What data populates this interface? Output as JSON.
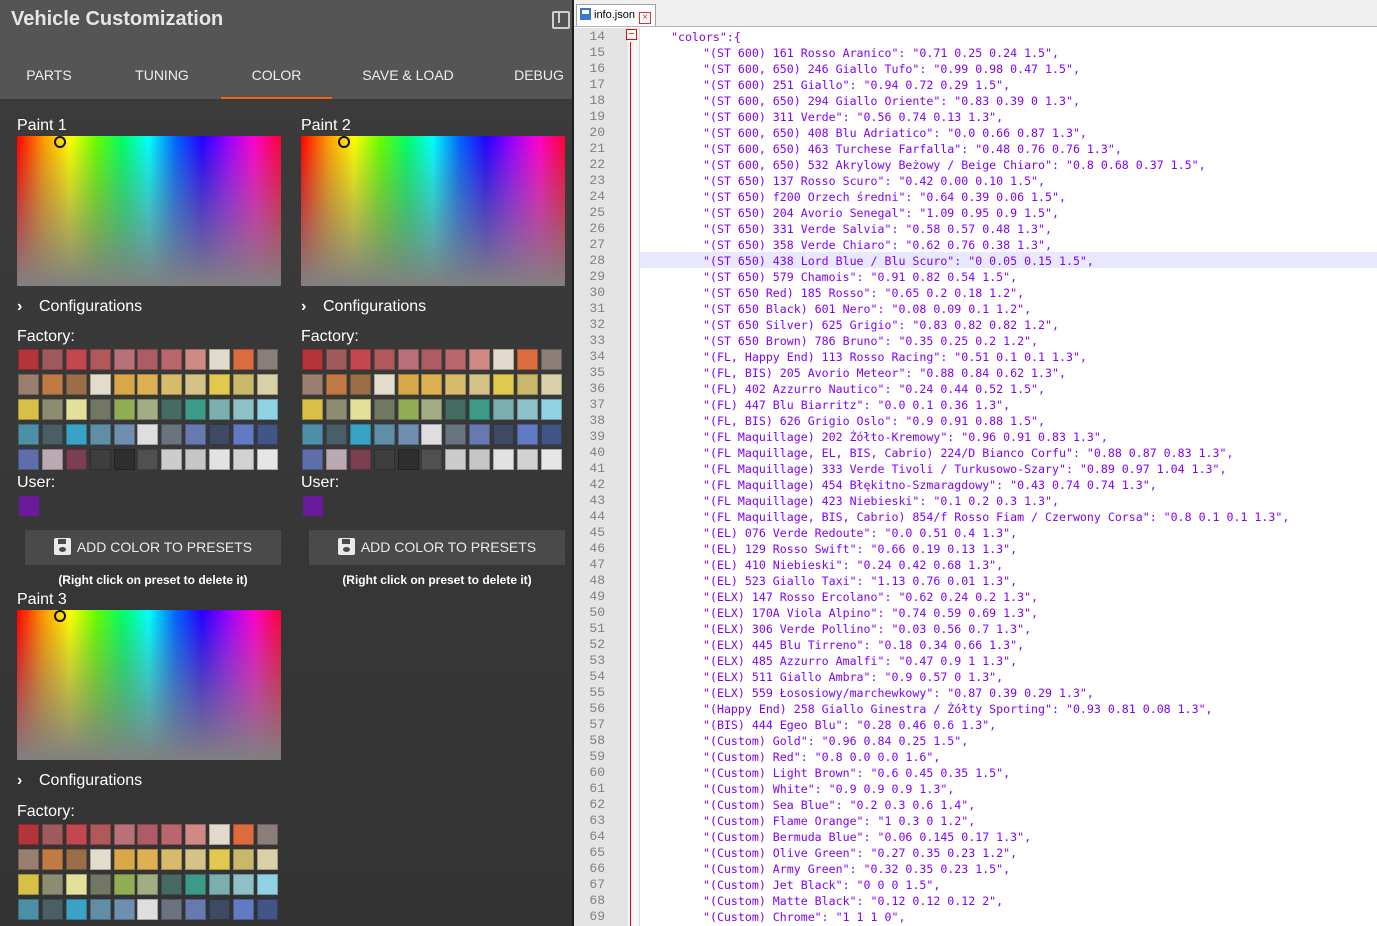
{
  "app": {
    "title": "Vehicle Customization",
    "tabs": [
      {
        "label": "PARTS",
        "active": false
      },
      {
        "label": "TUNING",
        "active": false
      },
      {
        "label": "COLOR",
        "active": true
      },
      {
        "label": "SAVE & LOAD",
        "active": false
      },
      {
        "label": "DEBUG",
        "active": false
      }
    ],
    "accent_color": "#e8651c"
  },
  "paints": [
    {
      "title": "Paint 1",
      "configurations_label": "Configurations",
      "factory_label": "Factory:",
      "user_label": "User:",
      "user_colors": [
        "#6a1b9a"
      ],
      "add_button_label": "ADD COLOR TO PRESETS",
      "hint": "(Right click on preset to delete it)"
    },
    {
      "title": "Paint 2",
      "configurations_label": "Configurations",
      "factory_label": "Factory:",
      "user_label": "User:",
      "user_colors": [
        "#6a1b9a"
      ],
      "add_button_label": "ADD COLOR TO PRESETS",
      "hint": "(Right click on preset to delete it)"
    },
    {
      "title": "Paint 3",
      "configurations_label": "Configurations",
      "factory_label": "Factory:"
    }
  ],
  "factory_swatches": [
    [
      "#b5343a",
      "#a05a5c",
      "#c2474f",
      "#b0585a",
      "#b8707a",
      "#ad5c66",
      "#b9676c",
      "#cf8a84",
      "#e2dacd",
      "#dc6b3e",
      "#8b7d78"
    ],
    [
      "#9a7e6e",
      "#c27a45",
      "#9b6e48",
      "#e2dccb",
      "#d8a848",
      "#ddb052",
      "#d7bb6a",
      "#d4c288",
      "#e0c94c",
      "#cab86a",
      "#d9cfa9"
    ],
    [
      "#d7bf48",
      "#8c8c70",
      "#e2e09a",
      "#727764",
      "#93ad55",
      "#a2ad83",
      "#466b62",
      "#3c9a87",
      "#7aafaf",
      "#8ec1c7",
      "#90d2e2"
    ],
    [
      "#4c8fa6",
      "#4a5e66",
      "#39a3c6",
      "#5f8ea6",
      "#6e8fb0",
      "#dedede",
      "#6a7380",
      "#667ab0",
      "#3d4a62",
      "#627ac4",
      "#435486"
    ],
    [
      "#5e6ea8",
      "#bbaab4",
      "#7a3f50",
      "#3e3e3e",
      "#2e2e2e",
      "#505050",
      "#cccccc",
      "#c6c6c6",
      "#e2e2e2",
      "#d2d2d2",
      "#e6e6e6"
    ]
  ],
  "editor": {
    "file_tab": "info.json",
    "lines": [
      {
        "n": "14",
        "t": "\"colors\":{"
      },
      {
        "n": "15",
        "t": "\"(ST 600) 161 Rosso Aranico\": \"0.71 0.25 0.24 1.5\","
      },
      {
        "n": "16",
        "t": "\"(ST 600, 650) 246 Giallo Tufo\": \"0.99 0.98 0.47 1.5\","
      },
      {
        "n": "17",
        "t": "\"(ST 600) 251 Giallo\": \"0.94 0.72 0.29 1.5\","
      },
      {
        "n": "18",
        "t": "\"(ST 600, 650) 294 Giallo Oriente\": \"0.83 0.39 0 1.3\","
      },
      {
        "n": "19",
        "t": "\"(ST 600) 311 Verde\": \"0.56 0.74 0.13 1.3\","
      },
      {
        "n": "20",
        "t": "\"(ST 600, 650) 408 Blu Adriatico\": \"0.0 0.66 0.87 1.3\","
      },
      {
        "n": "21",
        "t": "\"(ST 600, 650) 463 Turchese Farfalla\": \"0.48 0.76 0.76 1.3\","
      },
      {
        "n": "22",
        "t": "\"(ST 600, 650) 532 Akrylowy Beżowy / Beige Chiaro\": \"0.8 0.68 0.37 1.5\","
      },
      {
        "n": "23",
        "t": "\"(ST 650) 137 Rosso Scuro\": \"0.42 0.00 0.10 1.5\","
      },
      {
        "n": "24",
        "t": "\"(ST 650) f200 Orzech średni\": \"0.64 0.39 0.06 1.5\","
      },
      {
        "n": "25",
        "t": "\"(ST 650) 204 Avorio Senegal\": \"1.09 0.95 0.9 1.5\","
      },
      {
        "n": "26",
        "t": "\"(ST 650) 331 Verde Salvia\": \"0.58 0.57 0.48 1.3\","
      },
      {
        "n": "27",
        "t": "\"(ST 650) 358 Verde Chiaro\": \"0.62 0.76 0.38 1.3\","
      },
      {
        "n": "28",
        "t": "\"(ST 650) 438 Lord Blue / Blu Scuro\": \"0 0.05 0.15 1.5\","
      },
      {
        "n": "29",
        "t": "\"(ST 650) 579 Chamois\": \"0.91 0.82 0.54 1.5\","
      },
      {
        "n": "30",
        "t": "\"(ST 650 Red) 185 Rosso\": \"0.65 0.2 0.18 1.2\","
      },
      {
        "n": "31",
        "t": "\"(ST 650 Black) 601 Nero\": \"0.08 0.09 0.1 1.2\","
      },
      {
        "n": "32",
        "t": "\"(ST 650 Silver) 625 Grigio\": \"0.83 0.82 0.82 1.2\","
      },
      {
        "n": "33",
        "t": "\"(ST 650 Brown) 786 Bruno\": \"0.35 0.25 0.2 1.2\","
      },
      {
        "n": "34",
        "t": "\"(FL, Happy End) 113 Rosso Racing\": \"0.51 0.1 0.1 1.3\","
      },
      {
        "n": "35",
        "t": "\"(FL, BIS) 205 Avorio Meteor\": \"0.88 0.84 0.62 1.3\","
      },
      {
        "n": "36",
        "t": "\"(FL) 402 Azzurro Nautico\": \"0.24 0.44 0.52 1.5\","
      },
      {
        "n": "37",
        "t": "\"(FL) 447 Blu Biarritz\": \"0.0 0.1 0.36 1.3\","
      },
      {
        "n": "38",
        "t": "\"(FL, BIS) 626 Grigio Oslo\": \"0.9 0.91 0.88 1.5\","
      },
      {
        "n": "39",
        "t": "\"(FL Maquillage) 202 Żółto-Kremowy\": \"0.96 0.91 0.83 1.3\","
      },
      {
        "n": "40",
        "t": "\"(FL Maquillage, EL, BIS, Cabrio) 224/D Bianco Corfu\": \"0.88 0.87 0.83 1.3\","
      },
      {
        "n": "41",
        "t": "\"(FL Maquillage) 333 Verde Tivoli / Turkusowo-Szary\": \"0.89 0.97 1.04 1.3\","
      },
      {
        "n": "42",
        "t": "\"(FL Maquillage) 454 Błękitno-Szmaragdowy\": \"0.43 0.74 0.74 1.3\","
      },
      {
        "n": "43",
        "t": "\"(FL Maquillage) 423 Niebieski\": \"0.1 0.2 0.3 1.3\","
      },
      {
        "n": "44",
        "t": "\"(FL Maquillage, BIS, Cabrio) 854/f Rosso Fiam / Czerwony Corsa\": \"0.8 0.1 0.1 1.3\","
      },
      {
        "n": "45",
        "t": "\"(EL) 076 Verde Redoute\": \"0.0 0.51 0.4 1.3\","
      },
      {
        "n": "46",
        "t": "\"(EL) 129 Rosso Swift\": \"0.66 0.19 0.13 1.3\","
      },
      {
        "n": "47",
        "t": "\"(EL) 410 Niebieski\": \"0.24 0.42 0.68 1.3\","
      },
      {
        "n": "48",
        "t": "\"(EL) 523 Giallo Taxi\": \"1.13 0.76 0.01 1.3\","
      },
      {
        "n": "49",
        "t": "\"(ELX) 147 Rosso Ercolano\": \"0.62 0.24 0.2 1.3\","
      },
      {
        "n": "50",
        "t": "\"(ELX) 170A Viola Alpino\": \"0.74 0.59 0.69 1.3\","
      },
      {
        "n": "51",
        "t": "\"(ELX) 306 Verde Pollino\": \"0.03 0.56 0.7 1.3\","
      },
      {
        "n": "52",
        "t": "\"(ELX) 445 Blu Tirreno\": \"0.18 0.34 0.66 1.3\","
      },
      {
        "n": "53",
        "t": "\"(ELX) 485 Azzurro Amalfi\": \"0.47 0.9 1 1.3\","
      },
      {
        "n": "54",
        "t": "\"(ELX) 511 Giallo Ambra\": \"0.9 0.57 0 1.3\","
      },
      {
        "n": "55",
        "t": "\"(ELX) 559 Łososiowy/marchewkowy\": \"0.87 0.39 0.29 1.3\","
      },
      {
        "n": "56",
        "t": "\"(Happy End) 258 Giallo Ginestra / Żółty Sporting\": \"0.93 0.81 0.08 1.3\","
      },
      {
        "n": "57",
        "t": "\"(BIS) 444 Egeo Blu\": \"0.28 0.46 0.6 1.3\","
      },
      {
        "n": "58",
        "t": "\"(Custom) Gold\": \"0.96 0.84 0.25 1.5\","
      },
      {
        "n": "59",
        "t": "\"(Custom) Red\": \"0.8 0.0 0.0 1.6\","
      },
      {
        "n": "60",
        "t": "\"(Custom) Light Brown\": \"0.6 0.45 0.35 1.5\","
      },
      {
        "n": "61",
        "t": "\"(Custom) White\": \"0.9 0.9 0.9 1.3\","
      },
      {
        "n": "62",
        "t": "\"(Custom) Sea Blue\": \"0.2 0.3 0.6 1.4\","
      },
      {
        "n": "63",
        "t": "\"(Custom) Flame Orange\": \"1 0.3 0 1.2\","
      },
      {
        "n": "64",
        "t": "\"(Custom) Bermuda Blue\": \"0.06 0.145 0.17 1.3\","
      },
      {
        "n": "65",
        "t": "\"(Custom) Olive Green\": \"0.27 0.35 0.23 1.2\","
      },
      {
        "n": "66",
        "t": "\"(Custom) Army Green\": \"0.32 0.35 0.23 1.5\","
      },
      {
        "n": "67",
        "t": "\"(Custom) Jet Black\": \"0 0 0 1.5\","
      },
      {
        "n": "68",
        "t": "\"(Custom) Matte Black\": \"0.12 0.12 0.12 2\","
      },
      {
        "n": "69",
        "t": "\"(Custom) Chrome\": \"1 1 1 0\","
      }
    ]
  }
}
